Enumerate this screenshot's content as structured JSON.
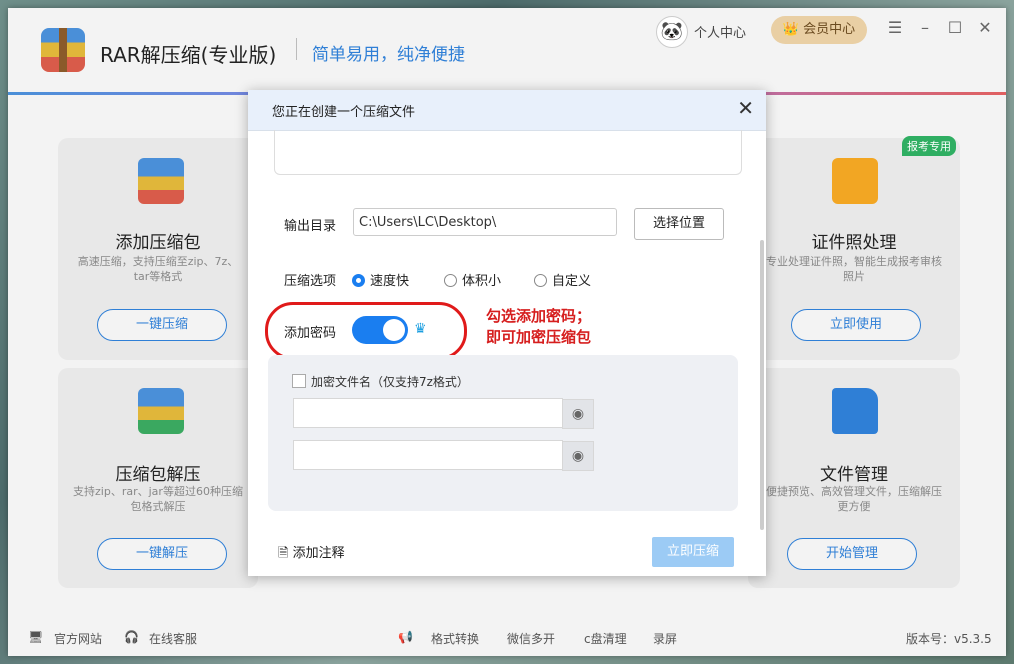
{
  "app": {
    "title": "RAR解压缩(专业版)",
    "slogan": "简单易用，纯净便捷",
    "personal_center": "个人中心",
    "vip_center": "会员中心",
    "window_controls": [
      "☰",
      "–",
      "☐",
      "✕"
    ]
  },
  "cards": [
    {
      "title": "添加压缩包",
      "desc": "高速压缩，支持压缩至zip、7z、tar等格式",
      "button": "一键压缩"
    },
    {
      "title": "证件照处理",
      "desc": "专业处理证件照，智能生成报考审核照片",
      "button": "立即使用",
      "badge": "报考专用"
    },
    {
      "title": "压缩包解压",
      "desc": "支持zip、rar、jar等超过60种压缩包格式解压",
      "button": "一键解压"
    },
    {
      "title": "文件管理",
      "desc": "便捷预览、高效管理文件，压缩解压更方便",
      "button": "开始管理"
    }
  ],
  "footer": {
    "website": "官方网站",
    "service": "在线客服",
    "tools": [
      "格式转换",
      "微信多开",
      "c盘清理",
      "录屏"
    ],
    "version": "版本号：v5.3.5"
  },
  "dialog": {
    "title": "您正在创建一个压缩文件",
    "output_label": "输出目录",
    "output_path": "C:\\Users\\LC\\Desktop\\",
    "choose_button": "选择位置",
    "options_label": "压缩选项",
    "options": [
      "速度快",
      "体积小",
      "自定义"
    ],
    "selected_option": "速度快",
    "password_label": "添加密码",
    "password_enabled": true,
    "encrypt_name_label": "加密文件名（仅支持7z格式）",
    "add_comment": "添加注释",
    "compress_button": "立即压缩"
  },
  "annotation": {
    "line1": "勾选添加密码；",
    "line2": "即可加密压缩包",
    "color": "#d61e1e"
  },
  "colors": {
    "accent": "#1a7ef0",
    "brand": "#2f7fd6"
  }
}
